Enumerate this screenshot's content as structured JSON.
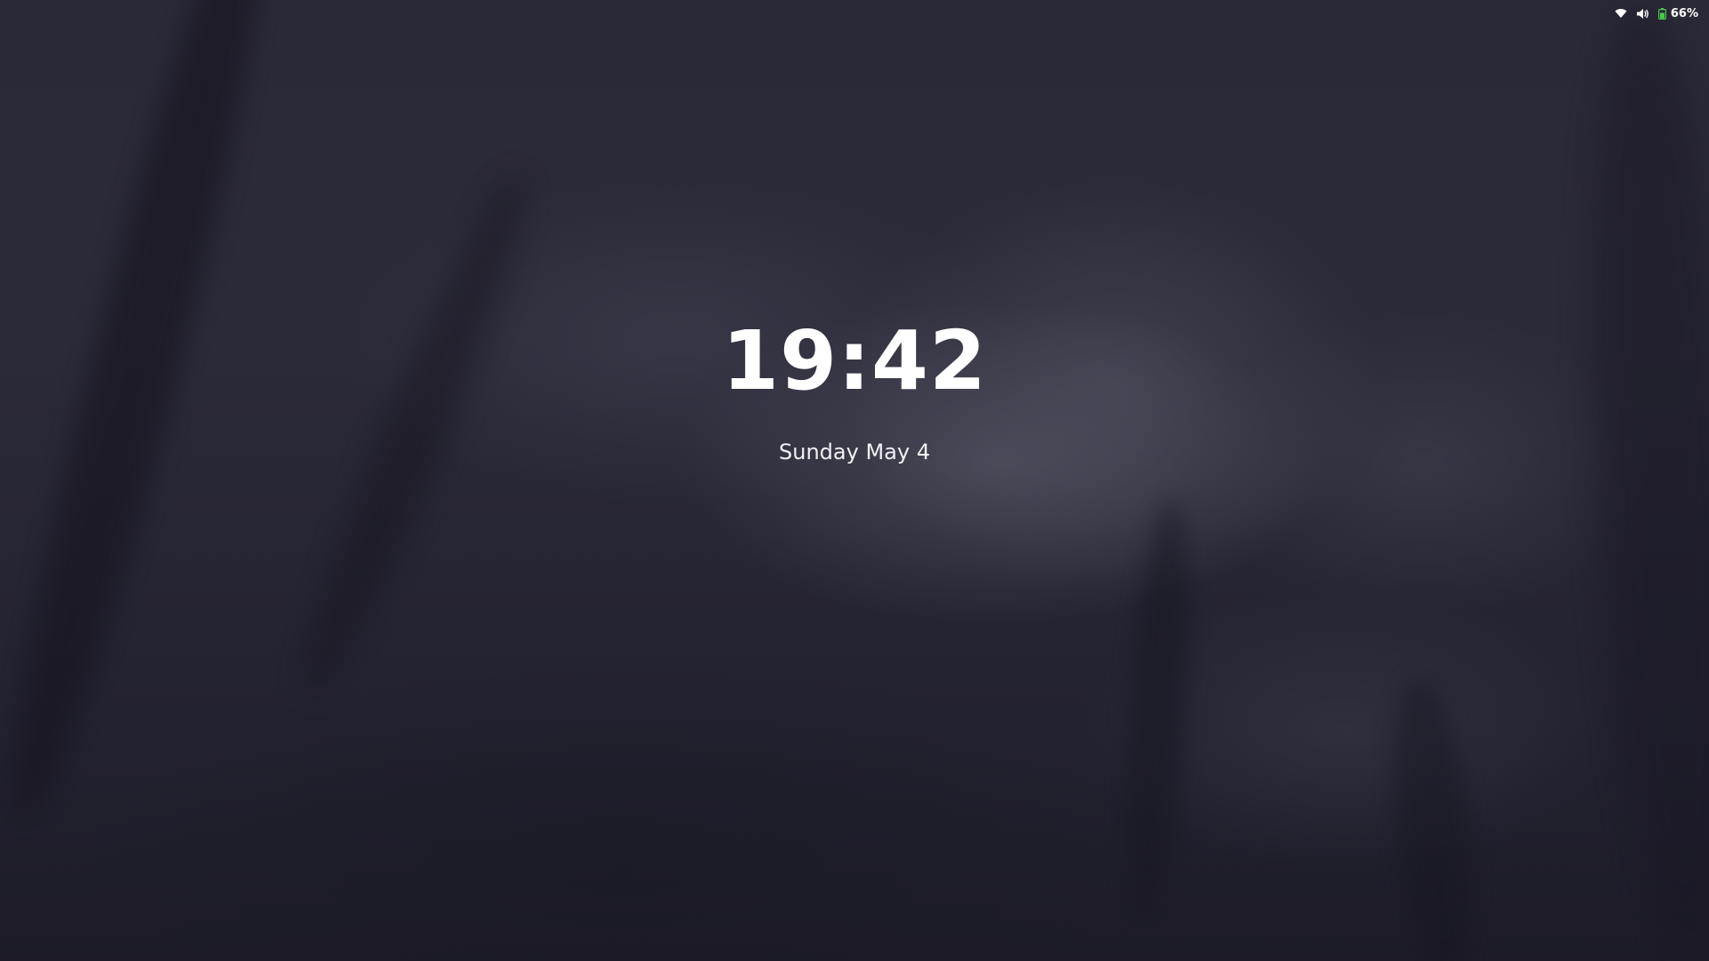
{
  "lock_screen": {
    "time": "19:42",
    "date": "Sunday May 4"
  },
  "status_bar": {
    "wifi_icon": "wifi-icon",
    "volume_icon": "volume-icon",
    "battery_icon": "battery-icon",
    "battery_level": 66,
    "battery_percent": "66%"
  },
  "colors": {
    "text": "#ffffff",
    "battery_accent": "#4cc84c",
    "background": "#24232f"
  }
}
